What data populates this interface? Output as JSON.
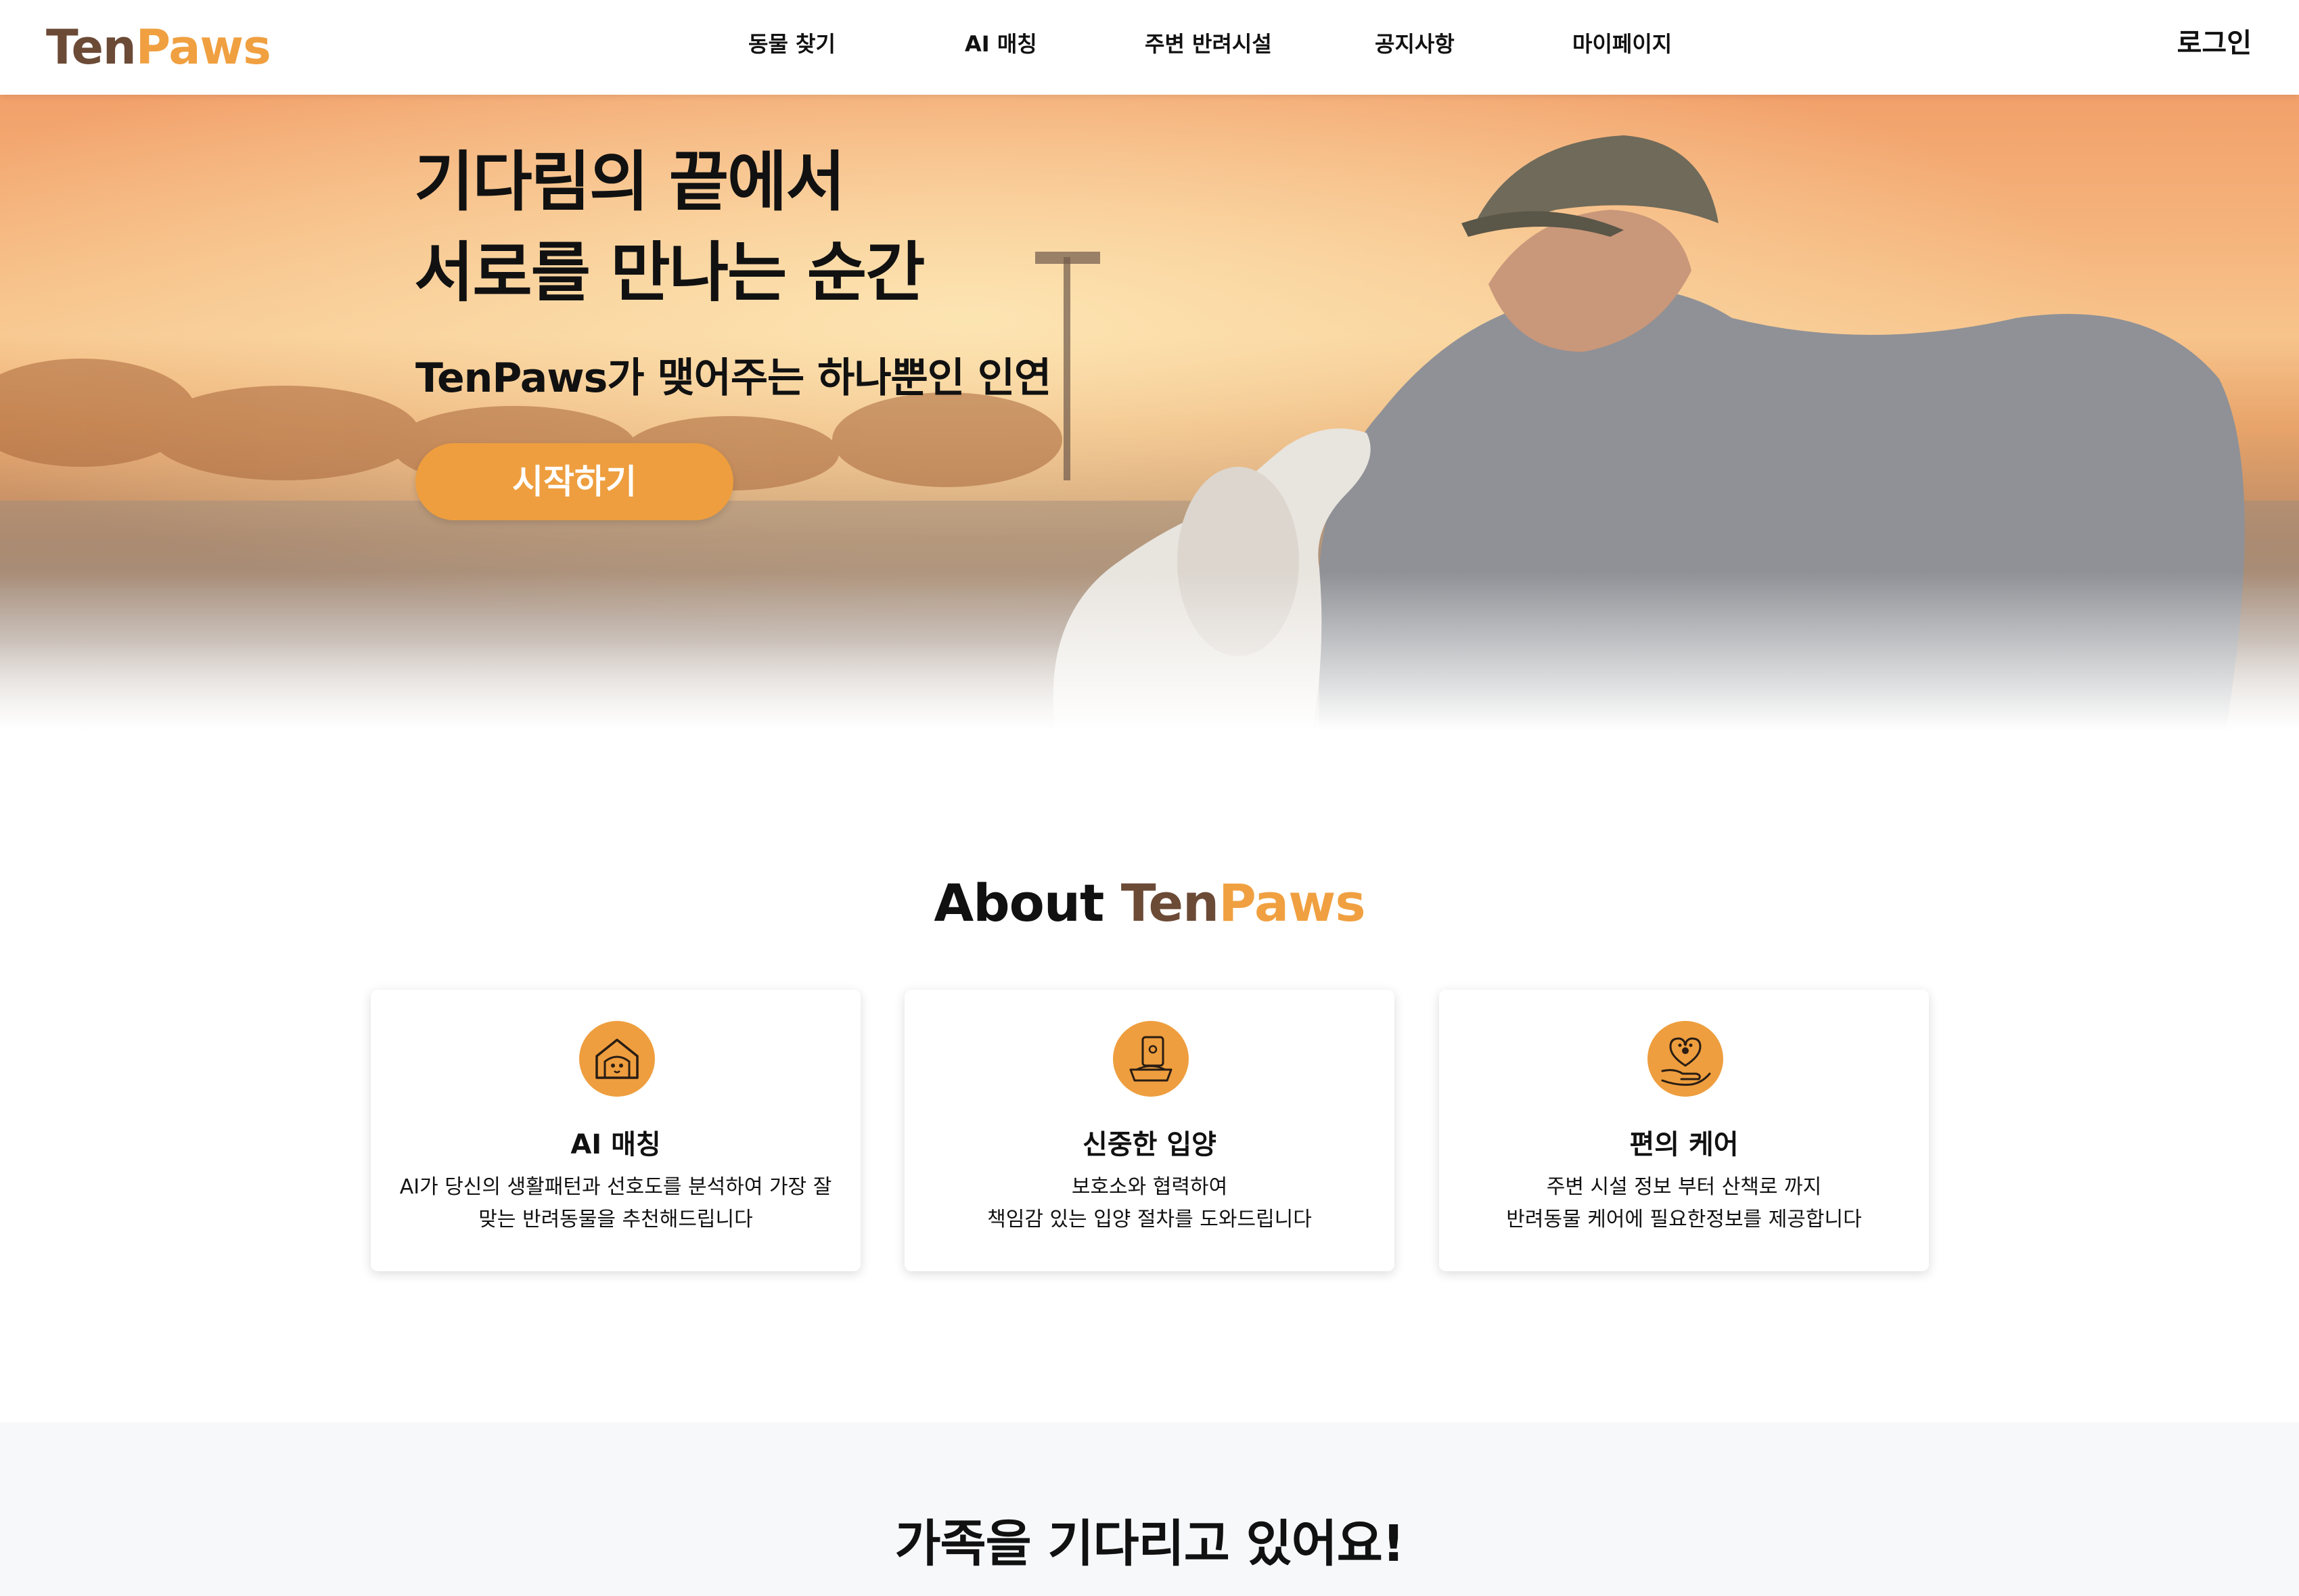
{
  "brand": {
    "logo_part1": "Ten",
    "logo_part2": "Paws",
    "color_dark": "#6b4a36",
    "color_accent": "#f0a040"
  },
  "nav": {
    "items": [
      {
        "label": "동물 찾기"
      },
      {
        "label": "AI 매칭"
      },
      {
        "label": "주변 반려시설"
      },
      {
        "label": "공지사항"
      },
      {
        "label": "마이페이지"
      }
    ],
    "login": "로그인"
  },
  "hero": {
    "title_line1": "기다림의 끝에서",
    "title_line2": "서로를 만나는 순간",
    "subtitle": "TenPaws가 맺어주는 하나뿐인 인연",
    "cta": "시작하기",
    "cta_color": "#ee9e3e"
  },
  "about": {
    "title_prefix": "About",
    "title_brand1": "Ten",
    "title_brand2": "Paws",
    "cards": [
      {
        "icon": "dog-house-heart-icon",
        "title": "AI 매칭",
        "desc": "AI가 당신의 생활패턴과 선호도를 분석하여 가장 잘 맞는 반려동물을 추천해드립니다"
      },
      {
        "icon": "pet-food-bowl-icon",
        "title": "신중한 입양",
        "desc_line1": "보호소와 협력하여",
        "desc_line2": "책임감 있는 입양 절차를 도와드립니다"
      },
      {
        "icon": "hand-heart-paw-icon",
        "title": "편의 케어",
        "desc_line1": "주변 시설 정보 부터 산책로 까지",
        "desc_line2": "반려동물 케어에 필요한정보를 제공합니다"
      }
    ]
  },
  "family": {
    "title": "가족을 기다리고 있어요!"
  }
}
